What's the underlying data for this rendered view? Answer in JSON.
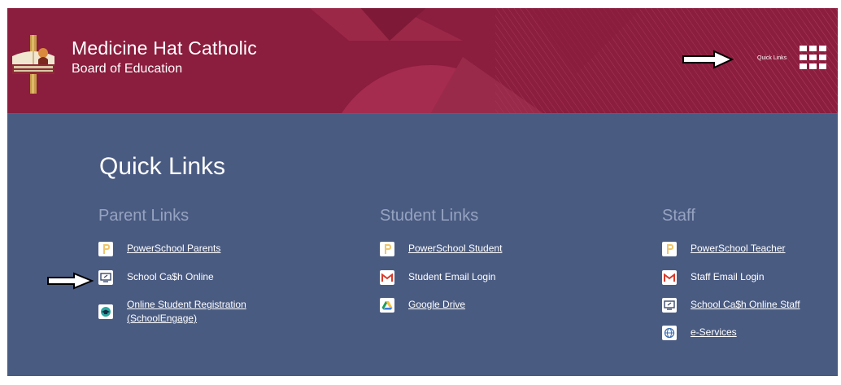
{
  "header": {
    "title": "Medicine Hat Catholic",
    "subtitle": "Board of Education",
    "quick_links_label": "Quick Links"
  },
  "section_title": "Quick Links",
  "columns": [
    {
      "title": "Parent Links",
      "links": [
        {
          "label": "PowerSchool Parents",
          "icon": "powerschool-icon",
          "underlined": true
        },
        {
          "label": "School Ca$h Online",
          "icon": "school-cash-icon",
          "underlined": false
        },
        {
          "label": "Online Student Registration",
          "label2": "(SchoolEngage)",
          "icon": "graduation-cap-icon",
          "underlined": true
        }
      ]
    },
    {
      "title": "Student Links",
      "links": [
        {
          "label": "PowerSchool Student",
          "icon": "powerschool-icon",
          "underlined": true
        },
        {
          "label": "Student Email Login",
          "icon": "gmail-icon",
          "underlined": false
        },
        {
          "label": "Google Drive",
          "icon": "google-drive-icon",
          "underlined": true
        }
      ]
    },
    {
      "title": "Staff",
      "links": [
        {
          "label": "PowerSchool Teacher",
          "icon": "powerschool-icon",
          "underlined": true
        },
        {
          "label": "Staff Email Login",
          "icon": "gmail-icon",
          "underlined": false
        },
        {
          "label": "School Ca$h Online Staff",
          "icon": "school-cash-icon",
          "underlined": true
        },
        {
          "label": "e-Services",
          "icon": "globe-icon",
          "underlined": true
        }
      ]
    }
  ],
  "colors": {
    "header_bg": "#8b1d3e",
    "content_bg": "#4a5b82",
    "column_title": "#96a3c0",
    "text": "#ffffff"
  }
}
